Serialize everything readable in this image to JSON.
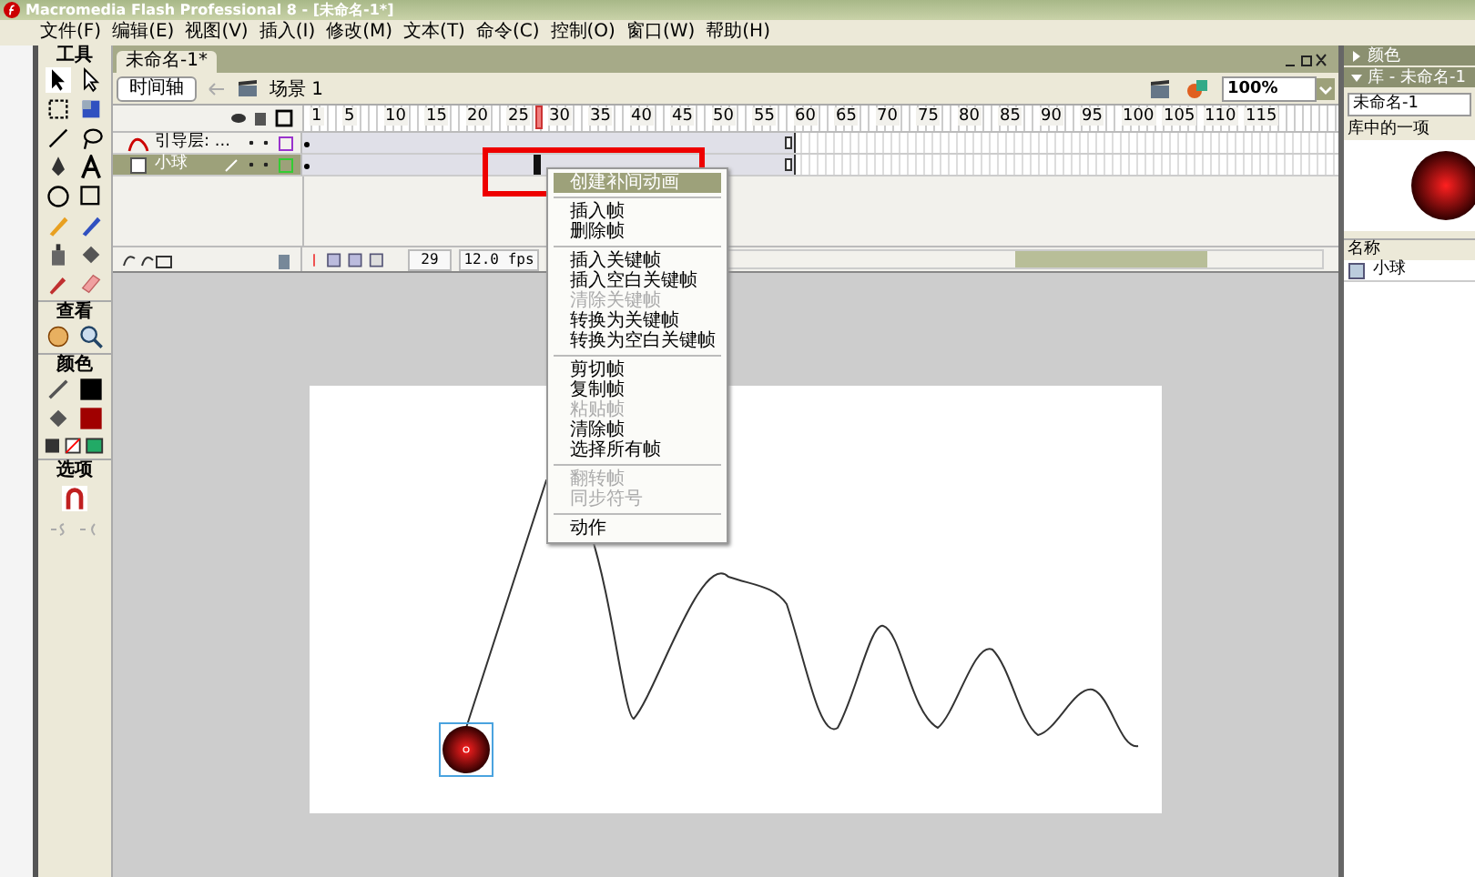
{
  "window": {
    "title": "Macromedia Flash Professional 8 - [未命名-1*]"
  },
  "menu": [
    "文件(F)",
    "编辑(E)",
    "视图(V)",
    "插入(I)",
    "修改(M)",
    "文本(T)",
    "命令(C)",
    "控制(O)",
    "窗口(W)",
    "帮助(H)"
  ],
  "tools": {
    "title": "工具",
    "sections": [
      "查看",
      "颜色",
      "选项"
    ]
  },
  "document_tab": "未命名-1*",
  "scene_bar": {
    "timeline_button": "时间轴",
    "scene": "场景 1",
    "zoom": "100%"
  },
  "timeline": {
    "ruler": [
      "1",
      "5",
      "10",
      "15",
      "20",
      "25",
      "30",
      "35",
      "40",
      "45",
      "50",
      "55",
      "60",
      "65",
      "70",
      "75",
      "80",
      "85",
      "90",
      "95",
      "100",
      "105",
      "110",
      "115"
    ],
    "layers": [
      {
        "name": "引导层: ...",
        "kind": "guide",
        "selected": false,
        "color": "#9933cc"
      },
      {
        "name": "小球",
        "kind": "normal",
        "selected": true,
        "color": "#33cc33"
      }
    ],
    "current_frame": "29",
    "fps": "12.0 fps"
  },
  "context_menu": [
    {
      "kind": "item",
      "label": "创建补间动画",
      "disabled": false,
      "selected": true
    },
    {
      "kind": "separator"
    },
    {
      "kind": "item",
      "label": "插入帧",
      "disabled": false,
      "selected": false
    },
    {
      "kind": "item",
      "label": "删除帧",
      "disabled": false,
      "selected": false
    },
    {
      "kind": "separator"
    },
    {
      "kind": "item",
      "label": "插入关键帧",
      "disabled": false,
      "selected": false
    },
    {
      "kind": "item",
      "label": "插入空白关键帧",
      "disabled": false,
      "selected": false
    },
    {
      "kind": "item",
      "label": "清除关键帧",
      "disabled": true,
      "selected": false
    },
    {
      "kind": "item",
      "label": "转换为关键帧",
      "disabled": false,
      "selected": false
    },
    {
      "kind": "item",
      "label": "转换为空白关键帧",
      "disabled": false,
      "selected": false
    },
    {
      "kind": "separator"
    },
    {
      "kind": "item",
      "label": "剪切帧",
      "disabled": false,
      "selected": false
    },
    {
      "kind": "item",
      "label": "复制帧",
      "disabled": false,
      "selected": false
    },
    {
      "kind": "item",
      "label": "粘贴帧",
      "disabled": true,
      "selected": false
    },
    {
      "kind": "item",
      "label": "清除帧",
      "disabled": false,
      "selected": false
    },
    {
      "kind": "item",
      "label": "选择所有帧",
      "disabled": false,
      "selected": false
    },
    {
      "kind": "separator"
    },
    {
      "kind": "item",
      "label": "翻转帧",
      "disabled": true,
      "selected": false
    },
    {
      "kind": "item",
      "label": "同步符号",
      "disabled": true,
      "selected": false
    },
    {
      "kind": "separator"
    },
    {
      "kind": "item",
      "label": "动作",
      "disabled": false,
      "selected": false
    }
  ],
  "right_panel": {
    "color_panel": "颜色",
    "library_panel": "库 - 未命名-1",
    "library_select": "未命名-1",
    "preview_label": "库中的一项",
    "name_header": "名称",
    "items": [
      "小球"
    ]
  }
}
